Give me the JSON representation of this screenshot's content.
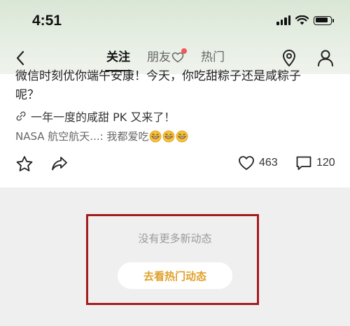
{
  "status_bar": {
    "time": "4:51"
  },
  "nav": {
    "tabs": [
      {
        "label": "关注",
        "active": true
      },
      {
        "label": "朋友",
        "has_heart": true,
        "has_dot": true
      },
      {
        "label": "热门"
      }
    ]
  },
  "post": {
    "text_cut": "微信时刻优你端午安康！今天，你吃甜粽子还是咸粽子",
    "text_end": "呢？",
    "topic": "一年一度的咸甜 PK 又来了！",
    "comment_preview": "NASA 航空航天...: 我都爱吃",
    "likes": "463",
    "comments": "120"
  },
  "feed_end": {
    "message": "没有更多新动态",
    "button_label": "去看热门动态"
  },
  "colors": {
    "accent_orange": "#e0a12b",
    "dot_red": "#f2565b",
    "highlight_border": "#a31c1f"
  }
}
